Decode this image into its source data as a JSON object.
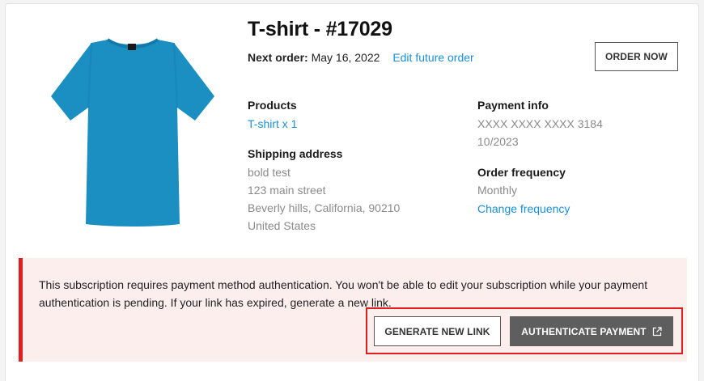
{
  "product": {
    "title": "T-shirt - #17029",
    "image_icon": "tshirt-image",
    "next_order_label": "Next order:",
    "next_order_date": "May 16, 2022",
    "edit_future_order": "Edit future order",
    "order_now": "ORDER NOW"
  },
  "products": {
    "label": "Products",
    "item": "T-shirt x 1"
  },
  "shipping": {
    "label": "Shipping address",
    "lines": [
      "bold test",
      "123 main street",
      "Beverly hills, California, 90210",
      "United States"
    ]
  },
  "payment": {
    "label": "Payment info",
    "card": "XXXX XXXX XXXX 3184",
    "expiry": "10/2023"
  },
  "frequency": {
    "label": "Order frequency",
    "value": "Monthly",
    "change": "Change frequency"
  },
  "alert": {
    "message": "This subscription requires payment method authentication. You won't be able to edit your subscription while your payment authentication is pending. If your link has expired, generate a new link.",
    "generate_link": "GENERATE NEW LINK",
    "authenticate": "AUTHENTICATE PAYMENT",
    "authenticate_icon": "external-link-icon"
  },
  "colors": {
    "link": "#1a8fd8",
    "alert_bg": "#fdeeee",
    "alert_border": "#e02020",
    "highlight": "#e11d1d",
    "shirt": "#1b8fc2",
    "primary_button": "#5e5e5e"
  }
}
